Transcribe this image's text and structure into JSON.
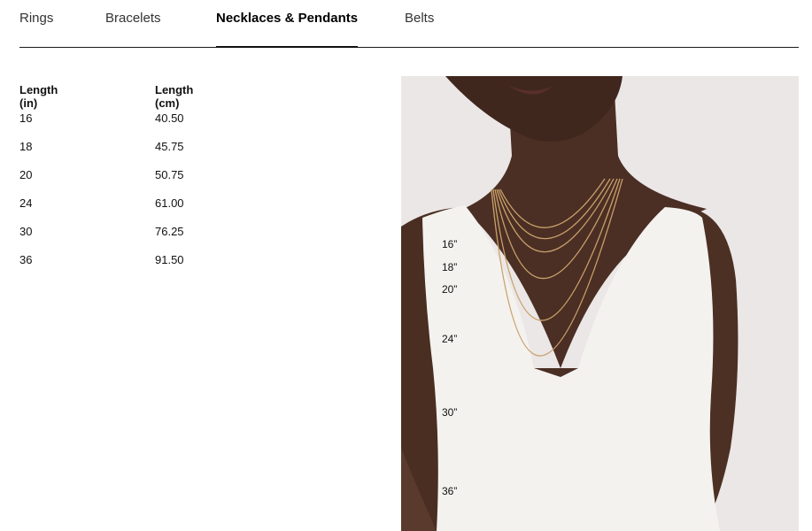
{
  "tabs": [
    {
      "label": "Rings"
    },
    {
      "label": "Bracelets"
    },
    {
      "label": "Necklaces & Pendants"
    },
    {
      "label": "Belts"
    }
  ],
  "table": {
    "headers": [
      "Length (in)",
      "Length (cm)"
    ],
    "rows": [
      [
        "16",
        "40.50"
      ],
      [
        "18",
        "45.75"
      ],
      [
        "20",
        "50.75"
      ],
      [
        "24",
        "61.00"
      ],
      [
        "30",
        "76.25"
      ],
      [
        "36",
        "91.50"
      ]
    ]
  },
  "image": {
    "length_marks": [
      "16”",
      "18”",
      "20”",
      "24”",
      "30”",
      "36”"
    ]
  }
}
